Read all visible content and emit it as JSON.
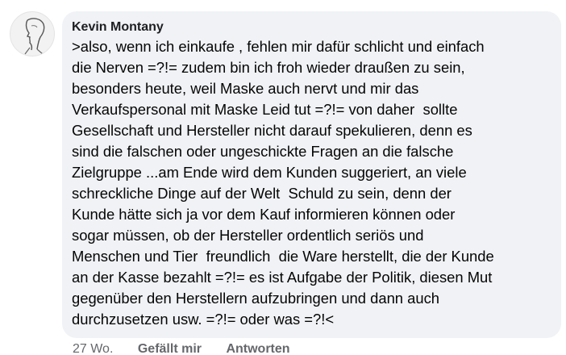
{
  "comment": {
    "author": "Kevin Montany",
    "avatar_icon": "profile-avatar-sketch-icon",
    "text": ">also, wenn ich einkaufe , fehlen mir dafür schlicht und einfach\ndie Nerven =?!= zudem bin ich froh wieder draußen zu sein,\nbesonders heute, weil Maske auch nervt und mir das\nVerkaufspersonal mit Maske Leid tut =?!= von daher  sollte\nGesellschaft und Hersteller nicht darauf spekulieren, denn es\nsind die falschen oder ungeschickte Fragen an die falsche\nZielgruppe ...am Ende wird dem Kunden suggeriert, an viele\nschreckliche Dinge auf der Welt  Schuld zu sein, denn der\nKunde hätte sich ja vor dem Kauf informieren können oder\nsogar müssen, ob der Hersteller ordentlich seriös und\nMenschen und Tier  freundlich  die Ware herstellt, die der Kunde\nan der Kasse bezahlt =?!= es ist Aufgabe der Politik, diesen Mut\ngegenüber den Herstellern aufzubringen und dann auch\ndurchzusetzen usw. =?!= oder was =?!<",
    "bubble_color": "#f0f2f5"
  },
  "actions": {
    "timestamp": "27 Wo.",
    "like_label": "Gefällt mir",
    "reply_label": "Antworten"
  }
}
